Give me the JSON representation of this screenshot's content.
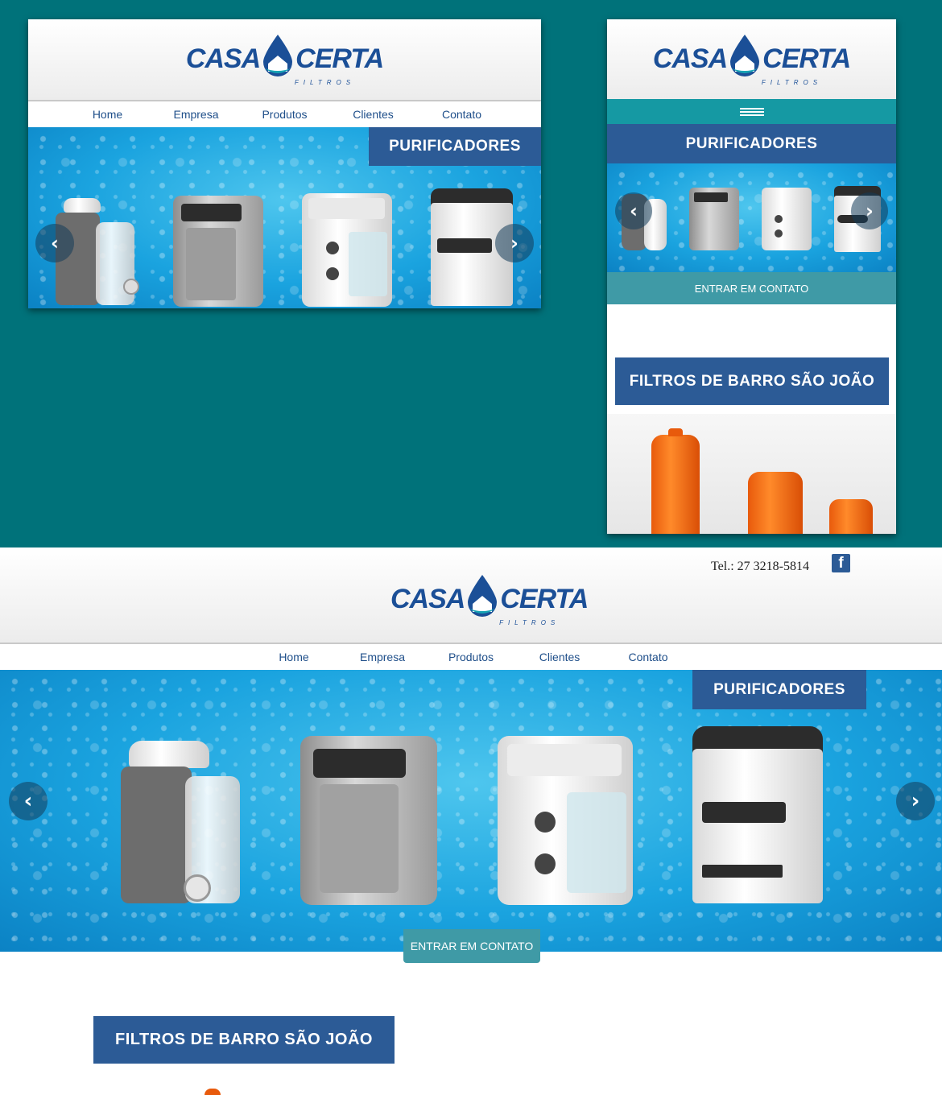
{
  "brand": {
    "name_left": "CASA",
    "name_right": "CERTA",
    "subtitle": "FILTROS"
  },
  "nav": {
    "items": [
      "Home",
      "Empresa",
      "Produtos",
      "Clientes",
      "Contato"
    ]
  },
  "slider": {
    "label": "PURIFICADORES"
  },
  "cta": {
    "label": "ENTRAR EM CONTATO"
  },
  "section2": {
    "label": "FILTROS DE BARRO SÃO JOÃO"
  },
  "contact": {
    "phone": "Tel.: 27 3218-5814"
  },
  "icons": {
    "prev": "chevron-left-icon",
    "next": "chevron-right-icon",
    "menu": "hamburger-menu-icon",
    "social": "facebook-icon",
    "logo": "water-drop-house-icon"
  },
  "colors": {
    "background": "#00727a",
    "brand_blue": "#2c5b96",
    "teal_bar": "#1599a3",
    "cta": "#3f9aa6",
    "nav_text": "#1f4f8a"
  }
}
